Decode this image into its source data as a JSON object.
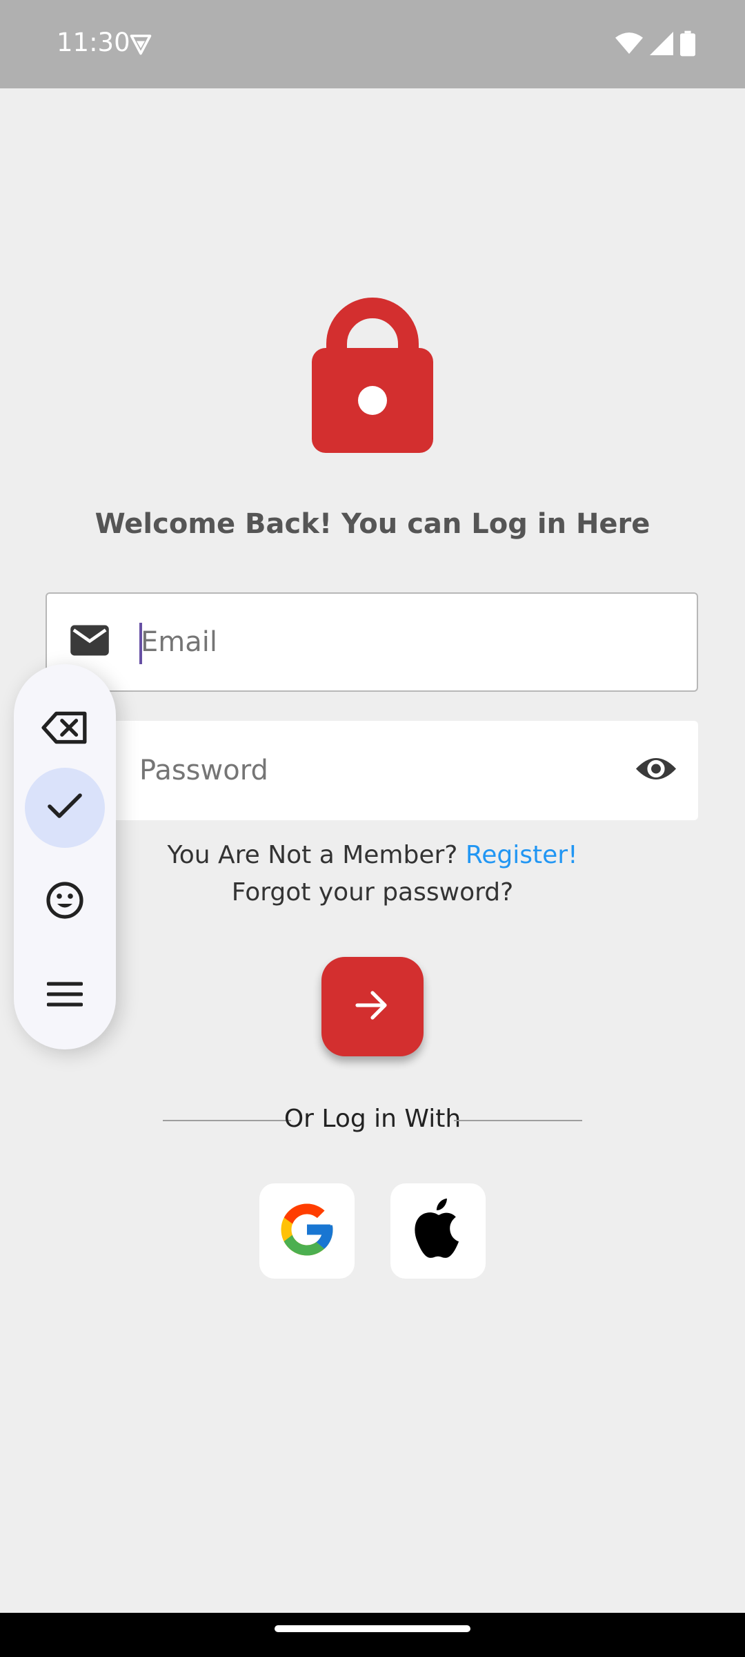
{
  "status_bar": {
    "time": "11:30"
  },
  "login": {
    "welcome_text": "Welcome Back! You can Log in Here",
    "email_placeholder": "Email",
    "password_placeholder": "Password",
    "member_prompt": "You Are Not a Member? ",
    "register_link": "Register!",
    "forgot_password": "Forgot your password?",
    "divider_text": "Or Log in With"
  },
  "icons": {
    "lock": "lock-icon",
    "email": "mail-icon",
    "password_visibility": "eye-icon",
    "submit": "arrow-right-icon",
    "google": "google-icon",
    "apple": "apple-icon"
  },
  "floating_toolbar": {
    "items": [
      "backspace-icon",
      "check-icon",
      "emoji-icon",
      "menu-icon"
    ],
    "active_item": "check-icon"
  },
  "colors": {
    "accent": "#d32f2f",
    "link": "#2196f3",
    "background": "#eeeeee",
    "caret": "#6750a4"
  }
}
